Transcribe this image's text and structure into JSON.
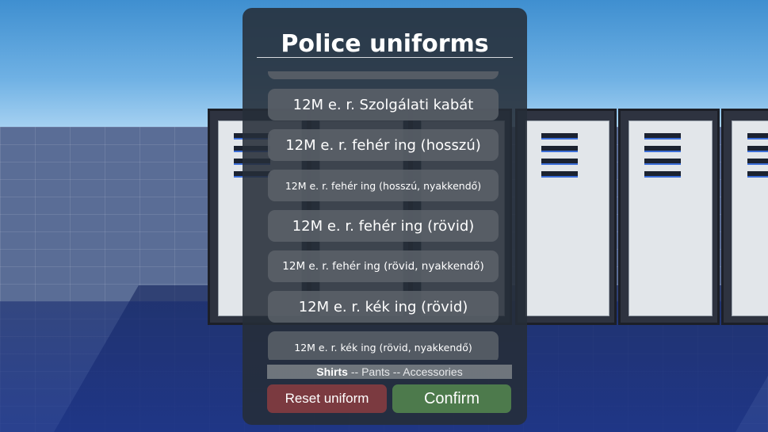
{
  "panel": {
    "title": "Police uniforms",
    "items": [
      {
        "label": "12M e. r. Szolgálati kabát"
      },
      {
        "label": "12M e. r. fehér ing (hosszú)"
      },
      {
        "label": "12M e. r. fehér ing (hosszú, nyakkendő)"
      },
      {
        "label": "12M e. r. fehér ing (rövid)"
      },
      {
        "label": "12M e. r. fehér ing (rövid, nyakkendő)"
      },
      {
        "label": "12M e. r. kék ing (rövid)"
      },
      {
        "label": "12M e. r. kék ing (rövid, nyakkendő)"
      }
    ],
    "tabs": {
      "shirts": "Shirts",
      "sep1": " -- ",
      "pants": "Pants",
      "sep2": " -- ",
      "accessories": "Accessories"
    },
    "reset_label": "Reset uniform",
    "confirm_label": "Confirm"
  },
  "colors": {
    "panel_bg": "#262e38",
    "item_bg": "#5c626a",
    "reset_bg": "#7b3a40",
    "confirm_bg": "#4d7a4c"
  }
}
